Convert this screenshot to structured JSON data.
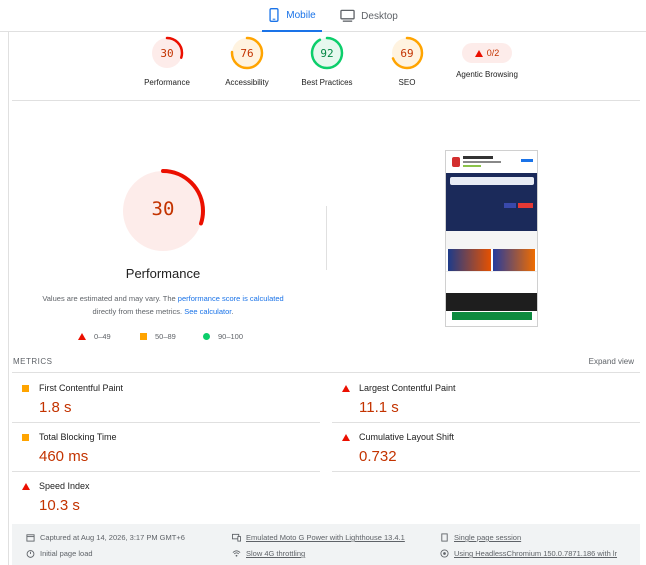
{
  "tabs": [
    {
      "label": "Mobile"
    },
    {
      "label": "Desktop"
    }
  ],
  "gauges": [
    {
      "label": "Performance",
      "score": "30",
      "value": 30,
      "color": "#eb0f00",
      "fill": "#fdecea",
      "text_color": "#c33300"
    },
    {
      "label": "Accessibility",
      "score": "76",
      "value": 76,
      "color": "#ffa400",
      "fill": "#fff3e0",
      "text_color": "#c33300"
    },
    {
      "label": "Best Practices",
      "score": "92",
      "value": 92,
      "color": "#0cce6b",
      "fill": "#e6f8ee",
      "text_color": "#018642"
    },
    {
      "label": "SEO",
      "score": "69",
      "value": 69,
      "color": "#ffa400",
      "fill": "#fff3e0",
      "text_color": "#c33300"
    },
    {
      "label": "Agentic Browsing",
      "score": "0/2"
    }
  ],
  "main": {
    "score": "30",
    "value": 30,
    "title": "Performance",
    "note_prefix": "Values are estimated and may vary. The ",
    "note_link1": "performance score is calculated",
    "note_mid": "directly from these metrics. ",
    "note_link2": "See calculator",
    "note_suffix": "."
  },
  "legend": [
    {
      "range": "0–49",
      "icon": "red-triangle-icon"
    },
    {
      "range": "50–89",
      "icon": "orange-square-icon"
    },
    {
      "range": "90–100",
      "icon": "green-circle-icon"
    }
  ],
  "metrics": {
    "heading": "METRICS",
    "expand_label": "Expand view",
    "items": [
      {
        "name": "First Contentful Paint",
        "value": "1.8 s",
        "status": "average"
      },
      {
        "name": "Largest Contentful Paint",
        "value": "11.1 s",
        "status": "fail"
      },
      {
        "name": "Total Blocking Time",
        "value": "460 ms",
        "status": "average"
      },
      {
        "name": "Cumulative Layout Shift",
        "value": "0.732",
        "status": "fail"
      },
      {
        "name": "Speed Index",
        "value": "10.3 s",
        "status": "fail"
      }
    ]
  },
  "footer": {
    "captured": "Captured at Aug 14, 2026, 3:17 PM GMT+6",
    "initial": "Initial page load",
    "device": "Emulated Moto G Power with Lighthouse 13.4.1",
    "throttling": "Slow 4G throttling",
    "session": "Single page session",
    "browser": "Using HeadlessChromium 150.0.7871.186 with lr"
  },
  "colors": {
    "accent": "#1a73e8",
    "fail": "#eb0f00",
    "average": "#ffa400",
    "pass": "#0cce6b"
  }
}
